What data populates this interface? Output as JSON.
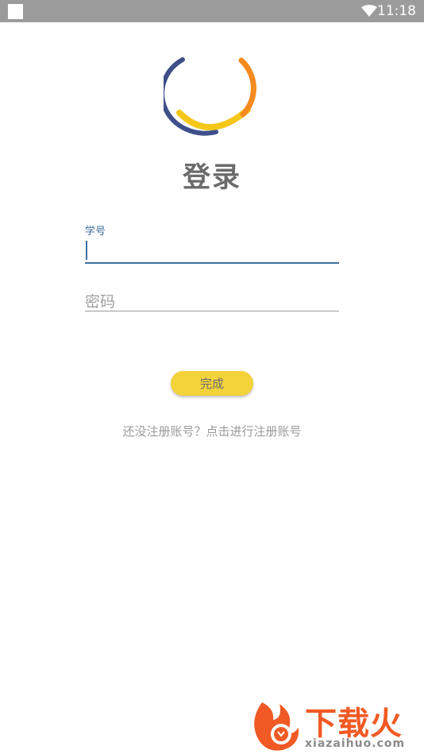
{
  "status_bar": {
    "time": "11:18"
  },
  "login": {
    "title": "登录",
    "student_id_label": "学号",
    "password_placeholder": "密码",
    "submit_label": "完成",
    "register_link": "还没注册账号？点击进行注册账号"
  },
  "watermark": {
    "brand_cn": "下载火",
    "domain": "xiazaihuo.com"
  },
  "colors": {
    "accent": "#3d6e9e",
    "button": "#f3d33a",
    "status_bar": "#9b9b9b",
    "logo_blue": "#3e4f8a",
    "logo_orange": "#f58a1f",
    "logo_yellow": "#f5c71a"
  }
}
